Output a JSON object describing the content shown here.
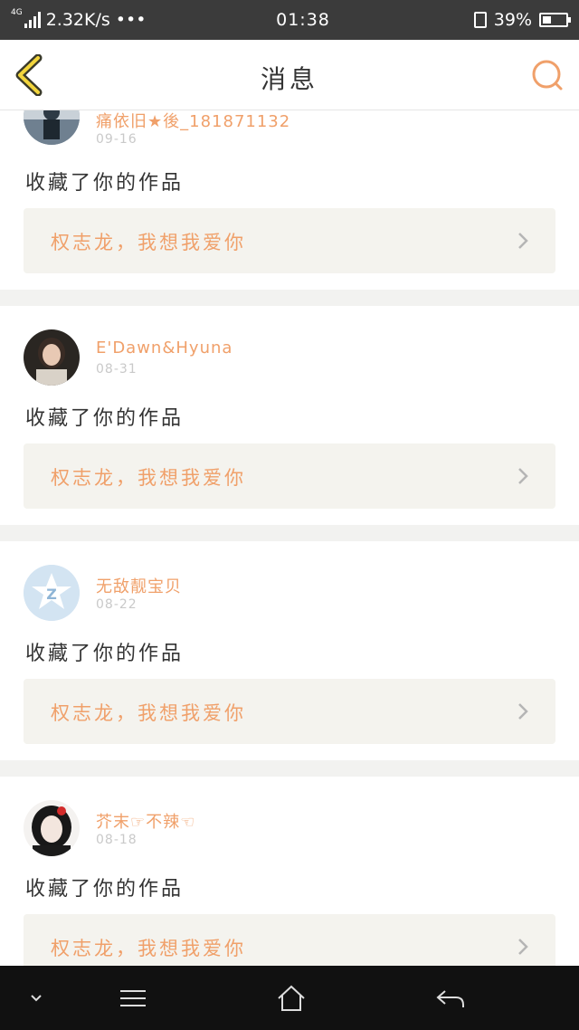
{
  "status_bar": {
    "network_type": "4G",
    "speed": "2.32K/s",
    "more": "•••",
    "time": "01:38",
    "battery": "39%",
    "battery_level": 0.39
  },
  "header": {
    "title": "消息",
    "back_icon": "chevron-left-icon",
    "search_icon": "search-icon"
  },
  "messages": [
    {
      "user": "痛依旧★後_181871132",
      "date": "09-16",
      "action": "收藏了你的作品",
      "work_title": "权志龙，我想我爱你",
      "avatar": "photo-avatar"
    },
    {
      "user": "E'Dawn&Hyuna",
      "date": "08-31",
      "action": "收藏了你的作品",
      "work_title": "权志龙，我想我爱你",
      "avatar": "photo-avatar"
    },
    {
      "user": "无敌靓宝贝",
      "date": "08-22",
      "action": "收藏了你的作品",
      "work_title": "权志龙，我想我爱你",
      "avatar": "qq-zone-avatar"
    },
    {
      "user": "芥末☞不辣☜",
      "date": "08-18",
      "action": "收藏了你的作品",
      "work_title": "权志龙，我想我爱你",
      "avatar": "illustration-avatar"
    }
  ],
  "colors": {
    "accent": "#f0a06a",
    "header_bg": "#ffffff",
    "status_bar_bg": "#3b3b3b",
    "nav_bar_bg": "#111111",
    "card_bg": "#ffffff",
    "work_bg": "#f4f3ee",
    "page_bg": "#f2f2f0"
  }
}
